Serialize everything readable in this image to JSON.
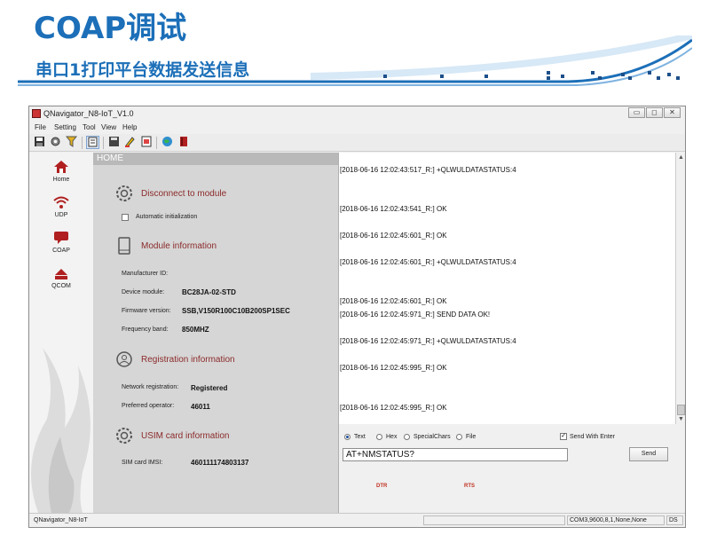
{
  "slide": {
    "title": "COAP调试",
    "subtitle": "串口1打印平台数据发送信息"
  },
  "window": {
    "title": "QNavigator_N8-IoT_V1.0",
    "controls": [
      "▭",
      "◻",
      "✕"
    ]
  },
  "menu": [
    "File",
    "Setting",
    "Tool",
    "View",
    "Help"
  ],
  "nav": [
    {
      "label": "Home",
      "icon": "home-icon"
    },
    {
      "label": "UDP",
      "icon": "wifi-icon"
    },
    {
      "label": "COAP",
      "icon": "chat-icon"
    },
    {
      "label": "QCOM",
      "icon": "transfer-icon"
    }
  ],
  "home_header": "HOME",
  "sections": {
    "disconnect": "Disconnect to module",
    "auto_init": "Automatic initialization",
    "module_info": "Module information",
    "manufacturer_label": "Manufacturer ID:",
    "manufacturer_val": "",
    "device_label": "Device module:",
    "device_val": "BC28JA-02-STD",
    "firmware_label": "Firmware version:",
    "firmware_val": "SSB,V150R100C10B200SP1SEC",
    "freq_label": "Frequency band:",
    "freq_val": "850MHZ",
    "reg_info": "Registration information",
    "netreg_label": "Network registration:",
    "netreg_val": "Registered",
    "operator_label": "Preferred operator:",
    "operator_val": "46011",
    "usim_info": "USIM card information",
    "imsi_label": "SIM card IMSI:",
    "imsi_val": "460111174803137"
  },
  "log": [
    "[2018-06-16 12:02:43:517_R:] +QLWULDATASTATUS:4",
    "[2018-06-16 12:02:43:541_R:] OK",
    "[2018-06-16 12:02:45:601_R:] OK",
    "[2018-06-16 12:02:45:601_R:] +QLWULDATASTATUS:4",
    "[2018-06-16 12:02:45:601_R:] OK",
    "[2018-06-16 12:02:45:971_R:] SEND DATA OK!",
    "[2018-06-16 12:02:45:971_R:] +QLWULDATASTATUS:4",
    "[2018-06-16 12:02:45:995_R:] OK",
    "[2018-06-16 12:02:45:995_R:] OK"
  ],
  "send": {
    "options": [
      "Text",
      "Hex",
      "SpecialChars",
      "File"
    ],
    "selected": "Text",
    "send_with_enter": "Send With Enter",
    "input_value": "AT+NMSTATUS?",
    "send_label": "Send",
    "dtr": "DTR",
    "rts": "RTS"
  },
  "status": {
    "app": "QNavigator_N8-IoT",
    "port": "COM3,9600,8,1,None,None",
    "tail": "DS"
  },
  "colors": {
    "brand_blue": "#1c6fb8",
    "section_red": "#8b2a2a",
    "panel_gray": "#d6d6d6"
  }
}
